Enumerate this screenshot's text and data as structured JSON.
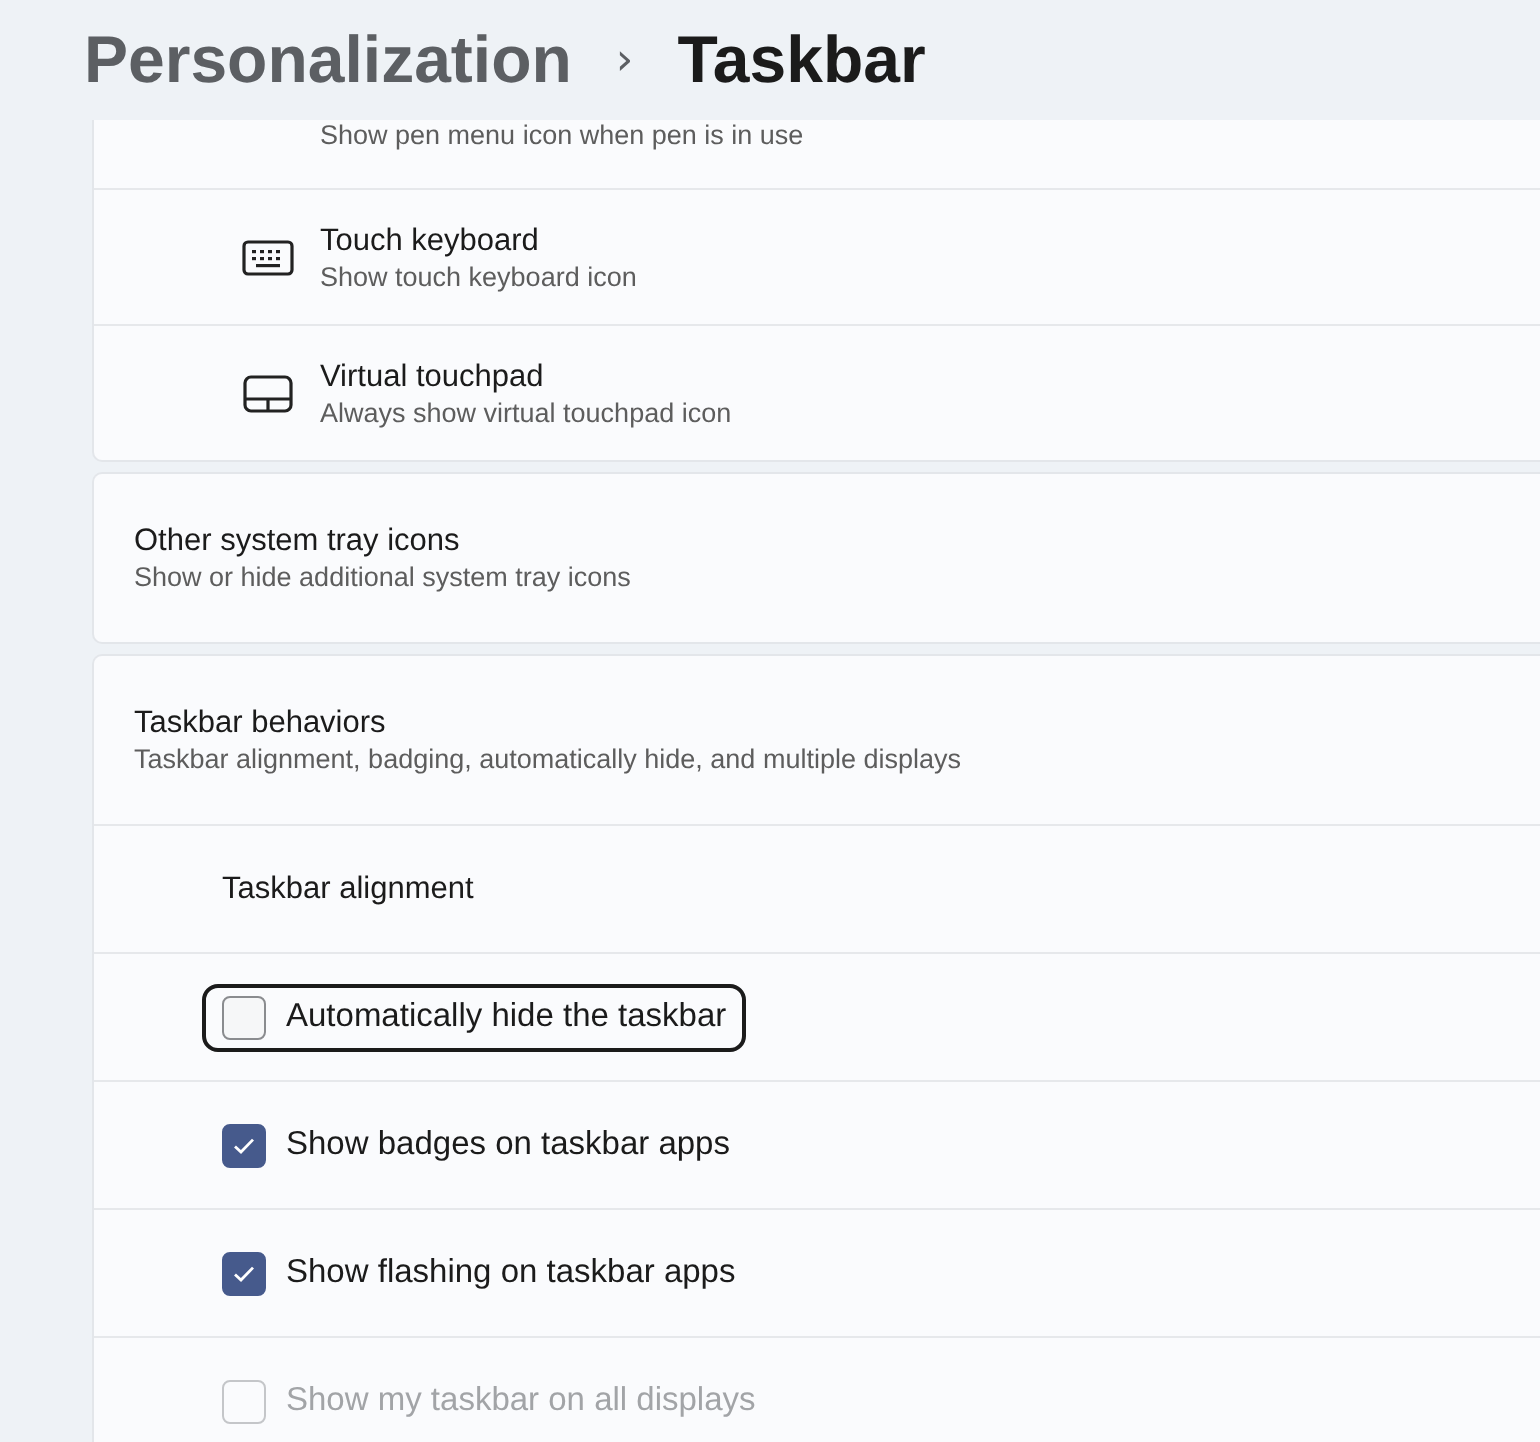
{
  "breadcrumb": {
    "parent": "Personalization",
    "separator": "›",
    "current": "Taskbar"
  },
  "tray_icons": [
    {
      "kind": "partial",
      "subtitle": "Show pen menu icon when pen is in use"
    },
    {
      "kind": "keyboard",
      "title": "Touch keyboard",
      "subtitle": "Show touch keyboard icon"
    },
    {
      "kind": "touchpad",
      "title": "Virtual touchpad",
      "subtitle": "Always show virtual touchpad icon"
    }
  ],
  "other_tray": {
    "title": "Other system tray icons",
    "subtitle": "Show or hide additional system tray icons"
  },
  "behaviors": {
    "title": "Taskbar behaviors",
    "subtitle": "Taskbar alignment, badging, automatically hide, and multiple displays",
    "alignment_label": "Taskbar alignment",
    "options": [
      {
        "label": "Automatically hide the taskbar",
        "checked": false,
        "focused": true,
        "disabled": false
      },
      {
        "label": "Show badges on taskbar apps",
        "checked": true,
        "focused": false,
        "disabled": false
      },
      {
        "label": "Show flashing on taskbar apps",
        "checked": true,
        "focused": false,
        "disabled": false
      },
      {
        "label": "Show my taskbar on all displays",
        "checked": false,
        "focused": false,
        "disabled": true
      }
    ]
  }
}
